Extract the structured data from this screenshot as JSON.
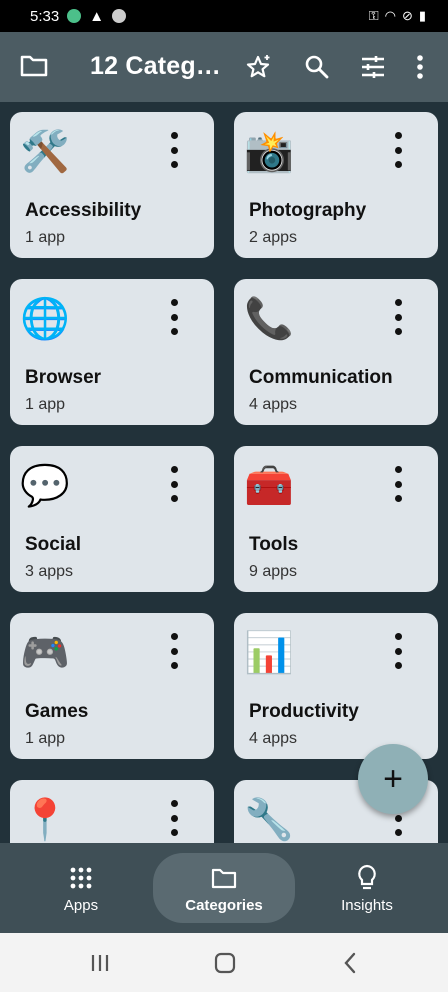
{
  "status_bar": {
    "time": "5:33"
  },
  "app_bar": {
    "title": "12 Categ…"
  },
  "categories": [
    {
      "name": "Accessibility",
      "count": "1 app",
      "icon": "🛠️",
      "icon_name": "hammer-wrench-icon"
    },
    {
      "name": "Photography",
      "count": "2 apps",
      "icon": "📸",
      "icon_name": "camera-flash-icon"
    },
    {
      "name": "Browser",
      "count": "1 app",
      "icon": "🌐",
      "icon_name": "globe-icon"
    },
    {
      "name": "Communication",
      "count": "4 apps",
      "icon": "📞",
      "icon_name": "telephone-icon"
    },
    {
      "name": "Social",
      "count": "3 apps",
      "icon": "💬",
      "icon_name": "speech-bubble-icon"
    },
    {
      "name": "Tools",
      "count": "9 apps",
      "icon": "🧰",
      "icon_name": "toolbox-icon"
    },
    {
      "name": "Games",
      "count": "1 app",
      "icon": "🎮",
      "icon_name": "game-controller-icon"
    },
    {
      "name": "Productivity",
      "count": "4 apps",
      "icon": "📊",
      "icon_name": "bar-chart-icon"
    },
    {
      "name": "",
      "count": "",
      "icon": "📍",
      "icon_name": "map-pin-icon"
    },
    {
      "name": "",
      "count": "",
      "icon": "🔧",
      "icon_name": "wrench-icon"
    }
  ],
  "fab": {
    "label": "+"
  },
  "bottom_nav": [
    {
      "label": "Apps",
      "active": false
    },
    {
      "label": "Categories",
      "active": true
    },
    {
      "label": "Insights",
      "active": false
    }
  ],
  "colors": {
    "app_bar": "#4c5c63",
    "card": "#dfe5ea",
    "fab": "#8fb0b6",
    "nav": "#3f4f56"
  }
}
